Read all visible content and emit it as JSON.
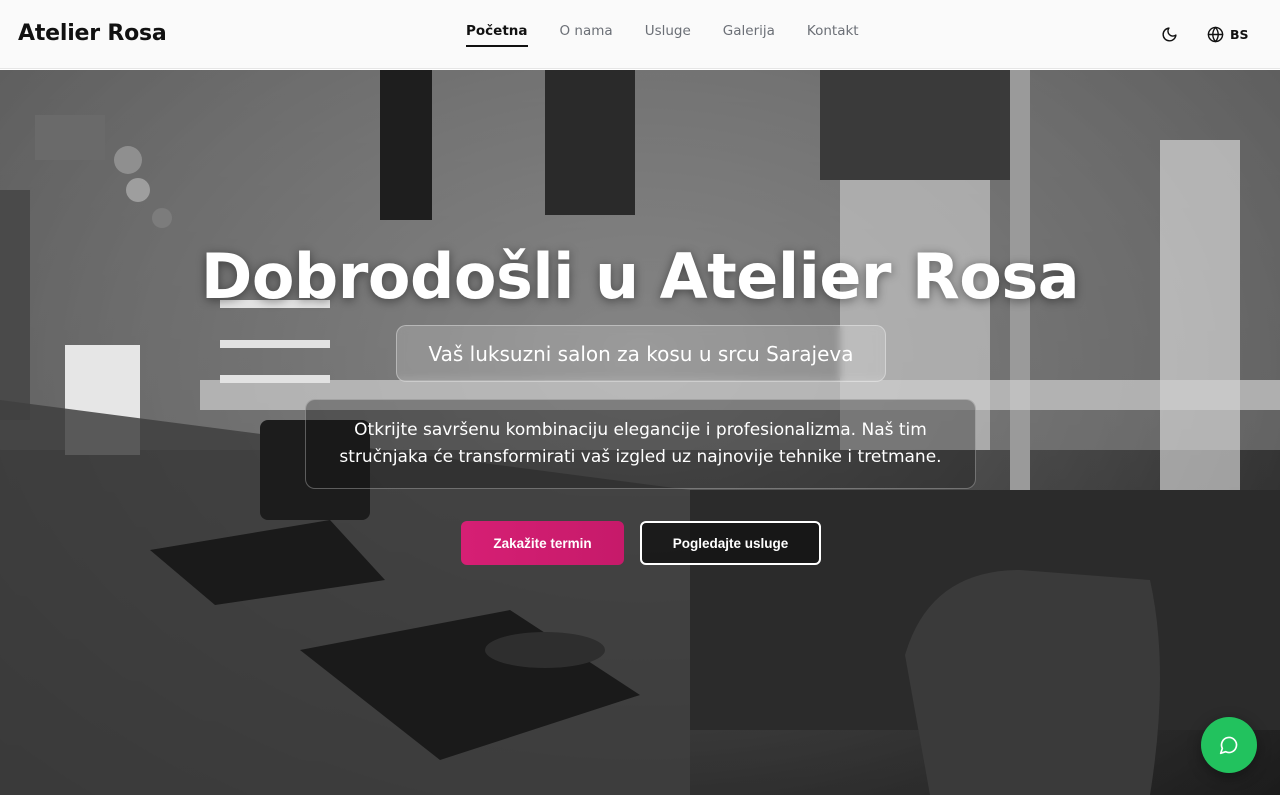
{
  "header": {
    "brand": "Atelier Rosa",
    "nav": [
      "Početna",
      "O nama",
      "Usluge",
      "Galerija",
      "Kontakt"
    ],
    "language": "BS",
    "icons": {
      "theme": "moon-icon",
      "language": "globe-icon"
    }
  },
  "hero": {
    "title": "Dobrodošli u Atelier Rosa",
    "subtitle": "Vaš luksuzni salon za kosu u srcu Sarajeva",
    "description": "Otkrijte savršenu kombinaciju elegancije i profesionalizma. Naš tim stručnjaka će transformirati vaš izgled uz najnovije tehnike i tretmane.",
    "primary_button": "Zakažite termin",
    "secondary_button": "Pogledajte usluge"
  },
  "colors": {
    "accent": "#d61f74",
    "chat_button": "#22c25e",
    "header_bg": "#fafafa"
  },
  "chat": {
    "icon": "chat-bubble-icon"
  }
}
